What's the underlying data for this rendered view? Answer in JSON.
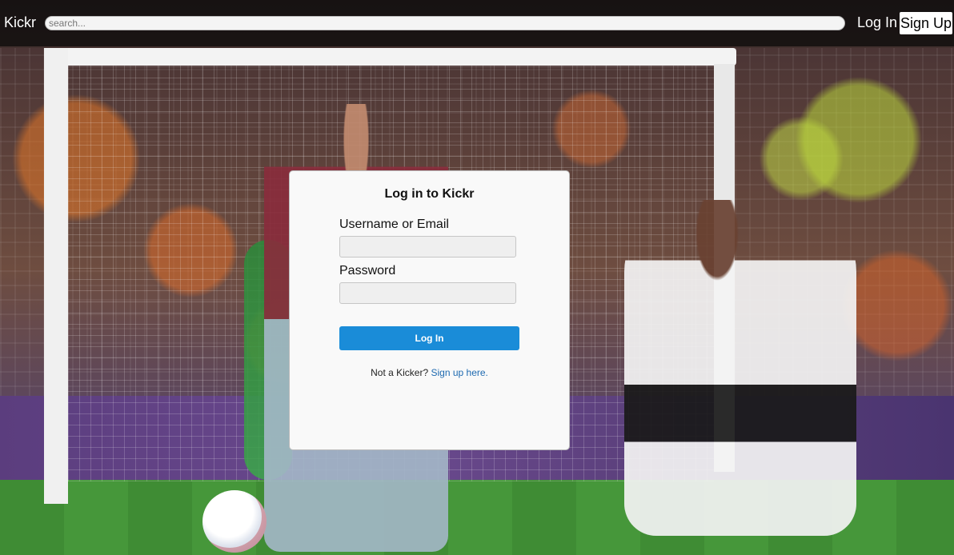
{
  "nav": {
    "logo": "Kickr",
    "search_placeholder": "search...",
    "login_label": "Log In",
    "signup_label": "Sign Up"
  },
  "login_card": {
    "title": "Log in to Kickr",
    "username_label": "Username or Email",
    "username_value": "",
    "password_label": "Password",
    "password_value": "",
    "submit_label": "Log In",
    "signup_prompt": "Not a Kicker?",
    "signup_link": "Sign up here."
  },
  "colors": {
    "primary_button": "#1a8cd8",
    "link": "#1e6ab0",
    "navbar": "#0a0a0a",
    "card_background": "#f9f9f9"
  },
  "background": {
    "subject": "soccer-match-photo"
  }
}
